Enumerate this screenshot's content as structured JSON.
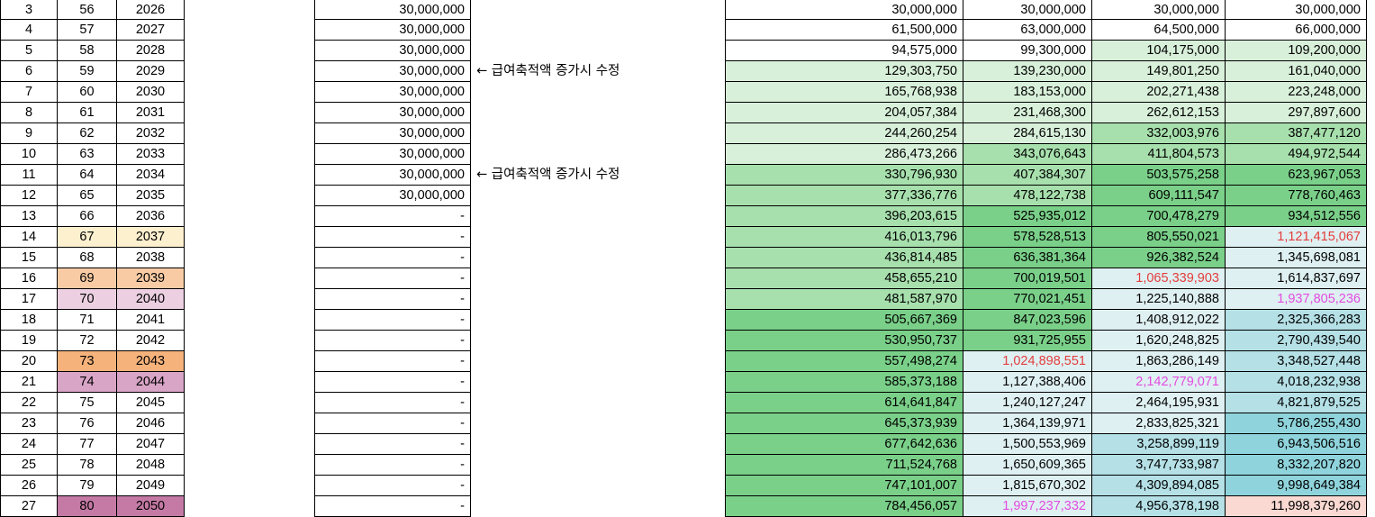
{
  "colors": {
    "lightgreen": "#d8f0da",
    "midgreen": "#a7e0ad",
    "darkgreen": "#7ad089",
    "lightblue": "#dff0f2",
    "midblue": "#b4e0e6",
    "darkblue": "#8fd4dc",
    "pinktext": "#e34ce0",
    "redtext": "#e33d3d",
    "hl_yellow": "#fdf0cf",
    "hl_peach": "#f8cba4",
    "hl_lightpink": "#ecd0e2",
    "hl_orange": "#f5b27b",
    "hl_mauve": "#d9a5c6",
    "hl_plum": "#c47aa5",
    "salmon": "#f9d9d2"
  },
  "sheet": {
    "rows": [
      {
        "n": "3",
        "age": "56",
        "year": "2026",
        "dep": "30,000,000",
        "note": "",
        "v": [
          "30,000,000",
          "30,000,000",
          "30,000,000",
          "30,000,000"
        ],
        "bg": [
          "",
          "",
          "",
          ""
        ],
        "fg": [
          "",
          "",
          "",
          ""
        ],
        "hl": ""
      },
      {
        "n": "4",
        "age": "57",
        "year": "2027",
        "dep": "30,000,000",
        "note": "",
        "v": [
          "61,500,000",
          "63,000,000",
          "64,500,000",
          "66,000,000"
        ],
        "bg": [
          "",
          "",
          "",
          ""
        ],
        "fg": [
          "",
          "",
          "",
          ""
        ],
        "hl": ""
      },
      {
        "n": "5",
        "age": "58",
        "year": "2028",
        "dep": "30,000,000",
        "note": "",
        "v": [
          "94,575,000",
          "99,300,000",
          "104,175,000",
          "109,200,000"
        ],
        "bg": [
          "",
          "",
          "lightgreen",
          "lightgreen"
        ],
        "fg": [
          "",
          "",
          "",
          ""
        ],
        "hl": ""
      },
      {
        "n": "6",
        "age": "59",
        "year": "2029",
        "dep": "30,000,000",
        "note": "← 급여축적액 증가시 수정",
        "v": [
          "129,303,750",
          "139,230,000",
          "149,801,250",
          "161,040,000"
        ],
        "bg": [
          "lightgreen",
          "lightgreen",
          "lightgreen",
          "lightgreen"
        ],
        "fg": [
          "",
          "",
          "",
          ""
        ],
        "hl": ""
      },
      {
        "n": "7",
        "age": "60",
        "year": "2030",
        "dep": "30,000,000",
        "note": "",
        "v": [
          "165,768,938",
          "183,153,000",
          "202,271,438",
          "223,248,000"
        ],
        "bg": [
          "lightgreen",
          "lightgreen",
          "lightgreen",
          "lightgreen"
        ],
        "fg": [
          "",
          "",
          "",
          ""
        ],
        "hl": ""
      },
      {
        "n": "8",
        "age": "61",
        "year": "2031",
        "dep": "30,000,000",
        "note": "",
        "v": [
          "204,057,384",
          "231,468,300",
          "262,612,153",
          "297,897,600"
        ],
        "bg": [
          "lightgreen",
          "lightgreen",
          "lightgreen",
          "lightgreen"
        ],
        "fg": [
          "",
          "",
          "",
          ""
        ],
        "hl": ""
      },
      {
        "n": "9",
        "age": "62",
        "year": "2032",
        "dep": "30,000,000",
        "note": "",
        "v": [
          "244,260,254",
          "284,615,130",
          "332,003,976",
          "387,477,120"
        ],
        "bg": [
          "lightgreen",
          "lightgreen",
          "midgreen",
          "midgreen"
        ],
        "fg": [
          "",
          "",
          "",
          ""
        ],
        "hl": ""
      },
      {
        "n": "10",
        "age": "63",
        "year": "2033",
        "dep": "30,000,000",
        "note": "",
        "v": [
          "286,473,266",
          "343,076,643",
          "411,804,573",
          "494,972,544"
        ],
        "bg": [
          "lightgreen",
          "midgreen",
          "midgreen",
          "midgreen"
        ],
        "fg": [
          "",
          "",
          "",
          ""
        ],
        "hl": ""
      },
      {
        "n": "11",
        "age": "64",
        "year": "2034",
        "dep": "30,000,000",
        "note": "← 급여축적액 증가시 수정",
        "v": [
          "330,796,930",
          "407,384,307",
          "503,575,258",
          "623,967,053"
        ],
        "bg": [
          "midgreen",
          "midgreen",
          "darkgreen",
          "darkgreen"
        ],
        "fg": [
          "",
          "",
          "",
          ""
        ],
        "hl": ""
      },
      {
        "n": "12",
        "age": "65",
        "year": "2035",
        "dep": "30,000,000",
        "note": "",
        "v": [
          "377,336,776",
          "478,122,738",
          "609,111,547",
          "778,760,463"
        ],
        "bg": [
          "midgreen",
          "midgreen",
          "darkgreen",
          "darkgreen"
        ],
        "fg": [
          "",
          "",
          "",
          ""
        ],
        "hl": ""
      },
      {
        "n": "13",
        "age": "66",
        "year": "2036",
        "dep": "-",
        "note": "",
        "v": [
          "396,203,615",
          "525,935,012",
          "700,478,279",
          "934,512,556"
        ],
        "bg": [
          "midgreen",
          "darkgreen",
          "darkgreen",
          "darkgreen"
        ],
        "fg": [
          "",
          "",
          "",
          ""
        ],
        "hl": ""
      },
      {
        "n": "14",
        "age": "67",
        "year": "2037",
        "dep": "-",
        "note": "",
        "v": [
          "416,013,796",
          "578,528,513",
          "805,550,021",
          "1,121,415,067"
        ],
        "bg": [
          "midgreen",
          "darkgreen",
          "darkgreen",
          "lightblue"
        ],
        "fg": [
          "",
          "",
          "",
          "redtext"
        ],
        "hl": "hl_yellow"
      },
      {
        "n": "15",
        "age": "68",
        "year": "2038",
        "dep": "-",
        "note": "",
        "v": [
          "436,814,485",
          "636,381,364",
          "926,382,524",
          "1,345,698,081"
        ],
        "bg": [
          "midgreen",
          "darkgreen",
          "darkgreen",
          "lightblue"
        ],
        "fg": [
          "",
          "",
          "",
          ""
        ],
        "hl": ""
      },
      {
        "n": "16",
        "age": "69",
        "year": "2039",
        "dep": "-",
        "note": "",
        "v": [
          "458,655,210",
          "700,019,501",
          "1,065,339,903",
          "1,614,837,697"
        ],
        "bg": [
          "midgreen",
          "darkgreen",
          "lightblue",
          "lightblue"
        ],
        "fg": [
          "",
          "",
          "redtext",
          ""
        ],
        "hl": "hl_peach"
      },
      {
        "n": "17",
        "age": "70",
        "year": "2040",
        "dep": "-",
        "note": "",
        "v": [
          "481,587,970",
          "770,021,451",
          "1,225,140,888",
          "1,937,805,236"
        ],
        "bg": [
          "midgreen",
          "darkgreen",
          "lightblue",
          "lightblue"
        ],
        "fg": [
          "",
          "",
          "",
          "pinktext"
        ],
        "hl": "hl_lightpink"
      },
      {
        "n": "18",
        "age": "71",
        "year": "2041",
        "dep": "-",
        "note": "",
        "v": [
          "505,667,369",
          "847,023,596",
          "1,408,912,022",
          "2,325,366,283"
        ],
        "bg": [
          "darkgreen",
          "darkgreen",
          "lightblue",
          "midblue"
        ],
        "fg": [
          "",
          "",
          "",
          ""
        ],
        "hl": ""
      },
      {
        "n": "19",
        "age": "72",
        "year": "2042",
        "dep": "-",
        "note": "",
        "v": [
          "530,950,737",
          "931,725,955",
          "1,620,248,825",
          "2,790,439,540"
        ],
        "bg": [
          "darkgreen",
          "darkgreen",
          "lightblue",
          "midblue"
        ],
        "fg": [
          "",
          "",
          "",
          ""
        ],
        "hl": ""
      },
      {
        "n": "20",
        "age": "73",
        "year": "2043",
        "dep": "-",
        "note": "",
        "v": [
          "557,498,274",
          "1,024,898,551",
          "1,863,286,149",
          "3,348,527,448"
        ],
        "bg": [
          "darkgreen",
          "lightblue",
          "lightblue",
          "midblue"
        ],
        "fg": [
          "",
          "redtext",
          "",
          ""
        ],
        "hl": "hl_orange"
      },
      {
        "n": "21",
        "age": "74",
        "year": "2044",
        "dep": "-",
        "note": "",
        "v": [
          "585,373,188",
          "1,127,388,406",
          "2,142,779,071",
          "4,018,232,938"
        ],
        "bg": [
          "darkgreen",
          "lightblue",
          "lightblue",
          "midblue"
        ],
        "fg": [
          "",
          "",
          "pinktext",
          ""
        ],
        "hl": "hl_mauve"
      },
      {
        "n": "22",
        "age": "75",
        "year": "2045",
        "dep": "-",
        "note": "",
        "v": [
          "614,641,847",
          "1,240,127,247",
          "2,464,195,931",
          "4,821,879,525"
        ],
        "bg": [
          "darkgreen",
          "lightblue",
          "lightblue",
          "midblue"
        ],
        "fg": [
          "",
          "",
          "",
          ""
        ],
        "hl": ""
      },
      {
        "n": "23",
        "age": "76",
        "year": "2046",
        "dep": "-",
        "note": "",
        "v": [
          "645,373,939",
          "1,364,139,971",
          "2,833,825,321",
          "5,786,255,430"
        ],
        "bg": [
          "darkgreen",
          "lightblue",
          "lightblue",
          "darkblue"
        ],
        "fg": [
          "",
          "",
          "",
          ""
        ],
        "hl": ""
      },
      {
        "n": "24",
        "age": "77",
        "year": "2047",
        "dep": "-",
        "note": "",
        "v": [
          "677,642,636",
          "1,500,553,969",
          "3,258,899,119",
          "6,943,506,516"
        ],
        "bg": [
          "darkgreen",
          "lightblue",
          "midblue",
          "darkblue"
        ],
        "fg": [
          "",
          "",
          "",
          ""
        ],
        "hl": ""
      },
      {
        "n": "25",
        "age": "78",
        "year": "2048",
        "dep": "-",
        "note": "",
        "v": [
          "711,524,768",
          "1,650,609,365",
          "3,747,733,987",
          "8,332,207,820"
        ],
        "bg": [
          "darkgreen",
          "lightblue",
          "midblue",
          "darkblue"
        ],
        "fg": [
          "",
          "",
          "",
          ""
        ],
        "hl": ""
      },
      {
        "n": "26",
        "age": "79",
        "year": "2049",
        "dep": "-",
        "note": "",
        "v": [
          "747,101,007",
          "1,815,670,302",
          "4,309,894,085",
          "9,998,649,384"
        ],
        "bg": [
          "darkgreen",
          "lightblue",
          "midblue",
          "darkblue"
        ],
        "fg": [
          "",
          "",
          "",
          ""
        ],
        "hl": ""
      },
      {
        "n": "27",
        "age": "80",
        "year": "2050",
        "dep": "-",
        "note": "",
        "v": [
          "784,456,057",
          "1,997,237,332",
          "4,956,378,198",
          "11,998,379,260"
        ],
        "bg": [
          "darkgreen",
          "lightblue",
          "midblue",
          "salmon"
        ],
        "fg": [
          "",
          "pinktext",
          "",
          ""
        ],
        "hl": "hl_plum"
      }
    ]
  }
}
